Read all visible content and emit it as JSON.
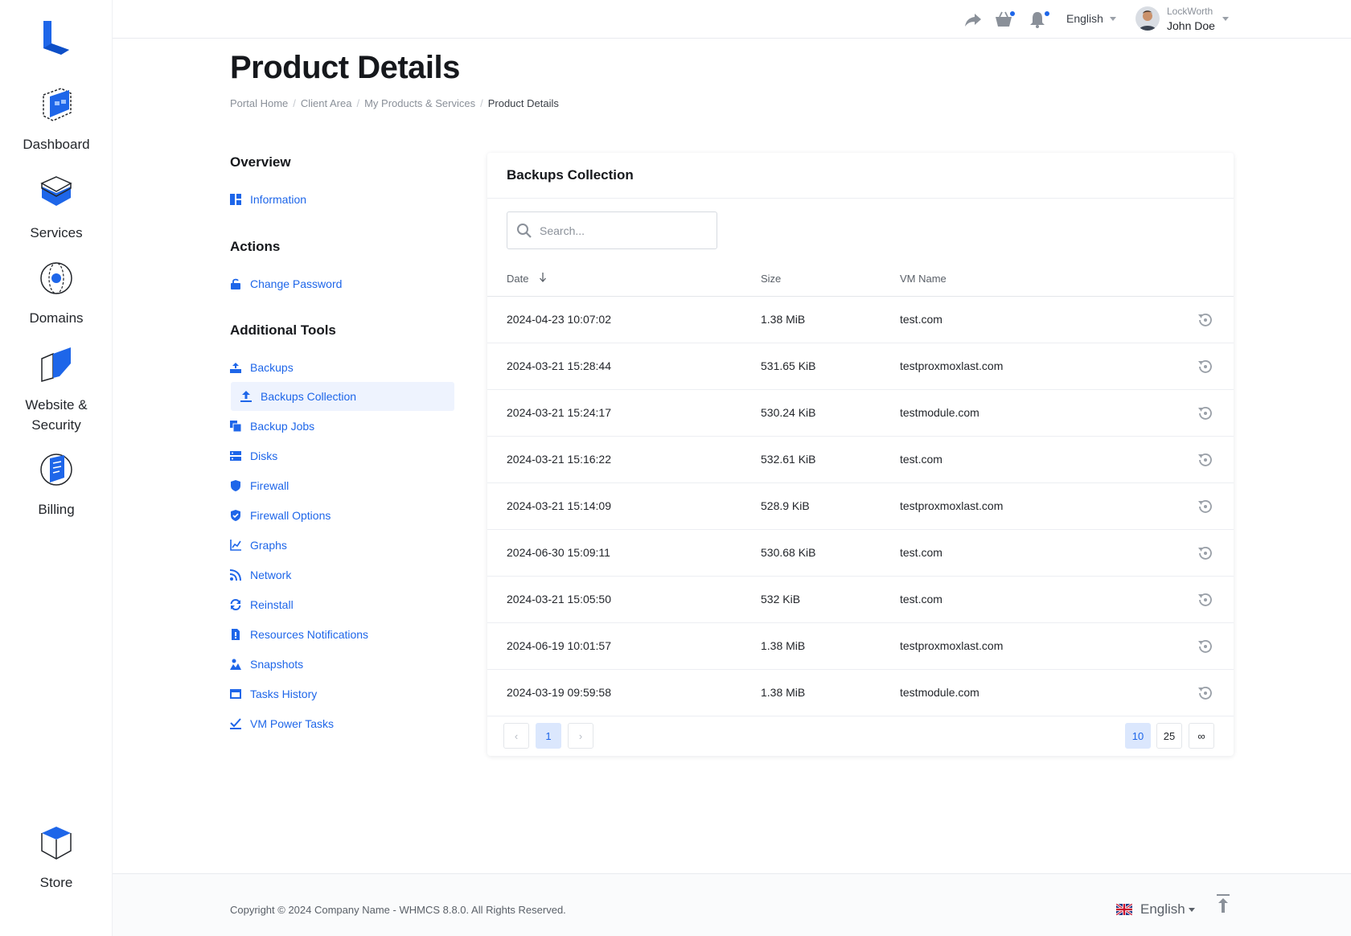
{
  "rail": {
    "items": [
      {
        "label": "Dashboard",
        "icon": "dashboard-icon"
      },
      {
        "label": "Services",
        "icon": "services-icon"
      },
      {
        "label": "Domains",
        "icon": "domains-icon"
      },
      {
        "label": "Website &",
        "label2": "Security",
        "icon": "website-security-icon"
      },
      {
        "label": "Billing",
        "icon": "billing-icon"
      },
      {
        "label": "Store",
        "icon": "store-icon"
      }
    ]
  },
  "topbar": {
    "language": "English",
    "company": "LockWorth",
    "user": "John Doe"
  },
  "page": {
    "title": "Product Details",
    "breadcrumb": [
      "Portal Home",
      "Client Area",
      "My Products & Services",
      "Product Details"
    ]
  },
  "sidebar": {
    "overview_heading": "Overview",
    "overview_items": [
      "Information"
    ],
    "actions_heading": "Actions",
    "actions_items": [
      "Change Password"
    ],
    "tools_heading": "Additional Tools",
    "tools_items": [
      "Backups",
      "Backups Collection",
      "Backup Jobs",
      "Disks",
      "Firewall",
      "Firewall Options",
      "Graphs",
      "Network",
      "Reinstall",
      "Resources Notifications",
      "Snapshots",
      "Tasks History",
      "VM Power Tasks"
    ],
    "active_item": "Backups Collection"
  },
  "card": {
    "title": "Backups Collection",
    "search_placeholder": "Search...",
    "columns": [
      "Date",
      "Size",
      "VM Name"
    ],
    "rows": [
      [
        "2024-04-23 10:07:02",
        "1.38 MiB",
        "test.com"
      ],
      [
        "2024-03-21 15:28:44",
        "531.65 KiB",
        "testproxmoxlast.com"
      ],
      [
        "2024-03-21 15:24:17",
        "530.24 KiB",
        "testmodule.com"
      ],
      [
        "2024-03-21 15:16:22",
        "532.61 KiB",
        "test.com"
      ],
      [
        "2024-03-21 15:14:09",
        "528.9 KiB",
        "testproxmoxlast.com"
      ],
      [
        "2024-06-30 15:09:11",
        "530.68 KiB",
        "test.com"
      ],
      [
        "2024-03-21 15:05:50",
        "532 KiB",
        "test.com"
      ],
      [
        "2024-06-19 10:01:57",
        "1.38 MiB",
        "testproxmoxlast.com"
      ],
      [
        "2024-03-19 09:59:58",
        "1.38 MiB",
        "testmodule.com"
      ]
    ],
    "pagination": {
      "prev": "‹",
      "current": "1",
      "next": "›"
    },
    "page_sizes": [
      "10",
      "25",
      "∞"
    ],
    "active_page_size": "10"
  },
  "footer": {
    "copyright": "Copyright © 2024 Company Name - WHMCS 8.8.0. All Rights Reserved.",
    "language": "English"
  },
  "colors": {
    "accent": "#1e66e9",
    "accent_light": "#eef3fe"
  }
}
